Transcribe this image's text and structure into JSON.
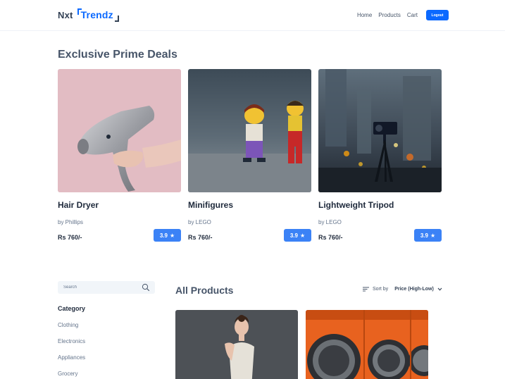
{
  "header": {
    "logo_nxt": "Nxt",
    "logo_trendz": "Trendz",
    "nav": [
      "Home",
      "Products",
      "Cart"
    ],
    "logout": "Logout"
  },
  "prime": {
    "title": "Exclusive Prime Deals",
    "items": [
      {
        "name": "Hair Dryer",
        "brand": "by Phillips",
        "price": "Rs 760/-",
        "rating": "3.9"
      },
      {
        "name": "Minifigures",
        "brand": "by LEGO",
        "price": "Rs 760/-",
        "rating": "3.9"
      },
      {
        "name": "Lightweight Tripod",
        "brand": "by LEGO",
        "price": "Rs 760/-",
        "rating": "3.9"
      }
    ]
  },
  "sidebar": {
    "search_placeholder": "Search",
    "category_heading": "Category",
    "categories": [
      "Clothing",
      "Electronics",
      "Appliances",
      "Grocery"
    ]
  },
  "products": {
    "title": "All Products",
    "sort_label": "Sort by",
    "sort_value": "Price (High-Low)"
  },
  "colors": {
    "accent": "#0b69ff",
    "rating_badge": "#3b82f6"
  },
  "icons": {
    "search": "search-icon",
    "sort": "sort-icon",
    "chevron": "chevron-down-icon",
    "star": "star-icon"
  }
}
